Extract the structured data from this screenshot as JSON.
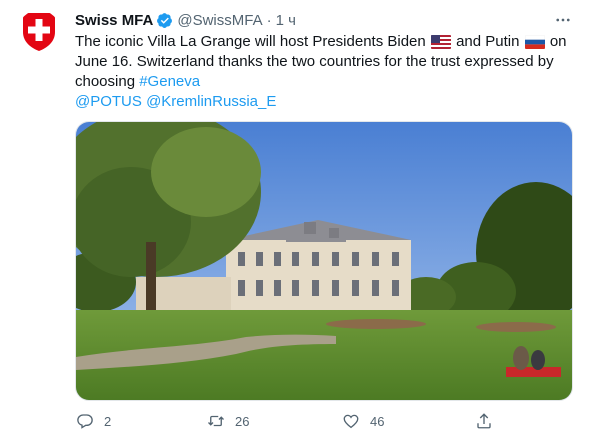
{
  "tweet": {
    "author_name": "Swiss MFA",
    "handle": "@SwissMFA",
    "separator": "·",
    "time": "1 ч",
    "text_line1_a": "The iconic Villa La Grange will host Presidents Biden",
    "text_line1_b": "and Putin",
    "text_line1_c": "on",
    "text_line2": "June 16. Switzerland thanks the two countries for the trust expressed by",
    "text_line3_a": "choosing",
    "hashtag": "#Geneva",
    "mention1": "@POTUS",
    "mention2": "@KremlinRussia_E",
    "link_color": "#1d9bf0",
    "avatar_icon": "swiss-flag-shield-icon",
    "verified_icon": "verified-badge-icon",
    "flag_us": "us-flag-emoji",
    "flag_ru": "russia-flag-emoji"
  },
  "actions": {
    "reply_count": "2",
    "retweet_count": "26",
    "like_count": "46",
    "reply_icon": "reply-icon",
    "retweet_icon": "retweet-icon",
    "like_icon": "heart-icon",
    "share_icon": "share-icon"
  },
  "media": {
    "description_icon": "photo-villa-la-grange"
  }
}
